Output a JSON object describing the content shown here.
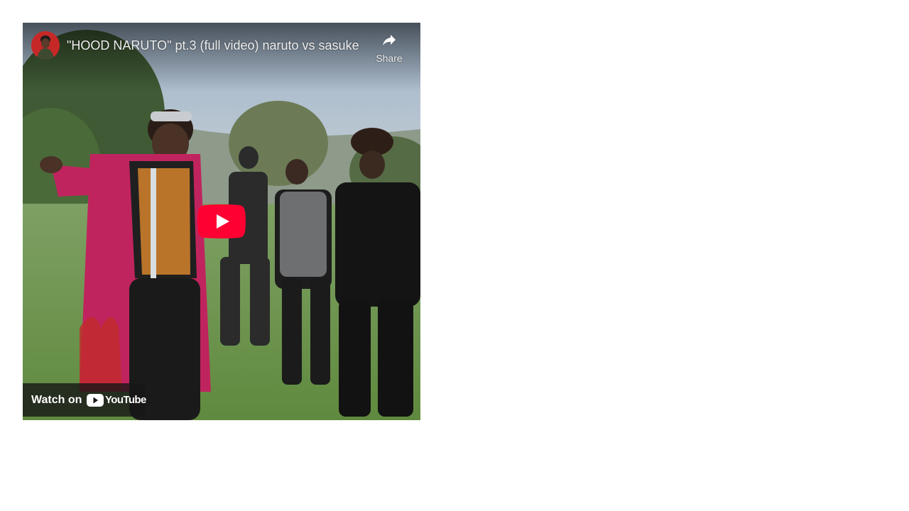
{
  "embed": {
    "title": "\"HOOD NARUTO\" pt.3 (full video) naruto vs sasuke",
    "share_label": "Share",
    "watch_on_label": "Watch on",
    "youtube_wordmark": "YouTube",
    "icons": {
      "avatar": "channel-avatar",
      "share": "share-arrow-icon",
      "play": "youtube-play-icon",
      "logo": "youtube-logo-icon"
    },
    "colors": {
      "play_red": "#ff0000",
      "overlay_bar": "#171717",
      "text": "#eeeeee"
    }
  }
}
